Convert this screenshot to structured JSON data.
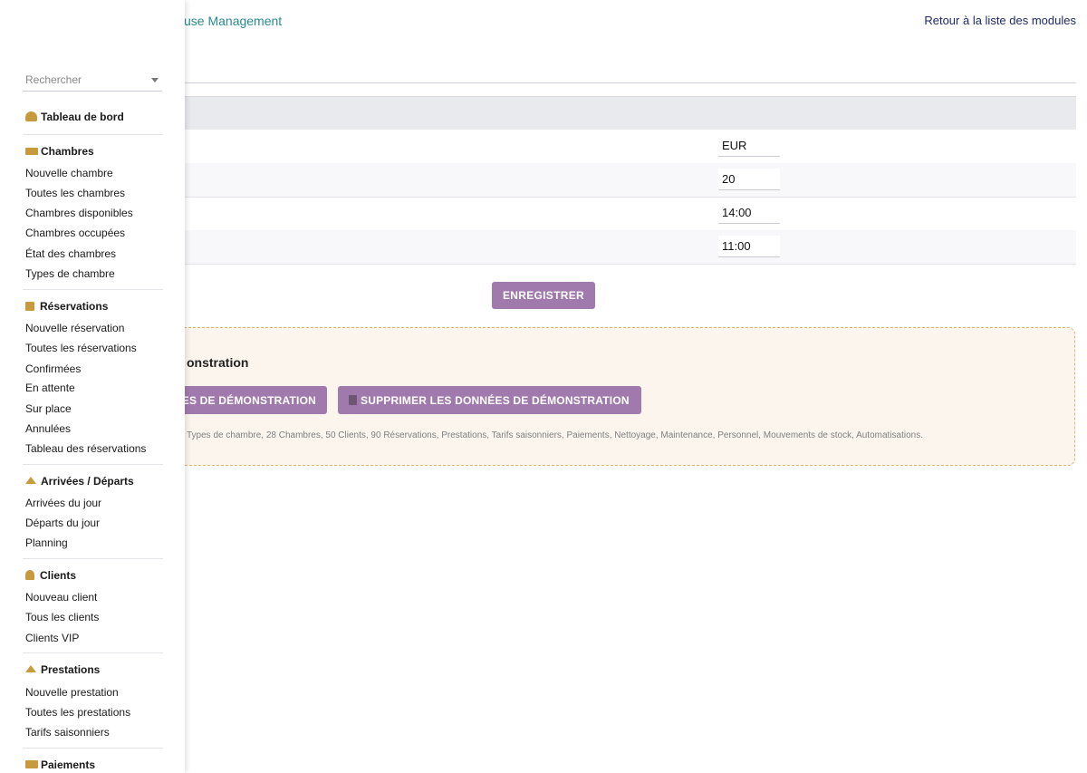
{
  "header": {
    "module_title": "use Management",
    "back_link": "Retour à la liste des modules"
  },
  "settings_rows": [
    {
      "value": "EUR"
    },
    {
      "value": "20"
    },
    {
      "value": "14:00"
    },
    {
      "value": "11:00"
    }
  ],
  "save_button": "ENREGISTRER",
  "demo": {
    "title": "onstration",
    "load_button": "ES DE DÉMONSTRATION",
    "delete_button": "SUPPRIMER LES DONNÉES DE DÉMONSTRATION",
    "note": "Types de chambre, 28 Chambres, 50 Clients, 90 Réservations, Prestations, Tarifs saisonniers, Paiements, Nettoyage, Maintenance, Personnel, Mouvements de stock, Automatisations."
  },
  "sidebar": {
    "search_placeholder": "Rechercher",
    "dashboard": "Tableau de bord",
    "chambres": {
      "title": "Chambres",
      "items": [
        "Nouvelle chambre",
        "Toutes les chambres",
        "Chambres disponibles",
        "Chambres occupées",
        "État des chambres",
        "Types de chambre"
      ]
    },
    "reservations": {
      "title": "Réservations",
      "items": [
        "Nouvelle réservation",
        "Toutes les réservations",
        "Confirmées",
        "En attente",
        "Sur place",
        "Annulées",
        "Tableau des réservations"
      ]
    },
    "arrivees": {
      "title": "Arrivées / Départs",
      "items": [
        "Arrivées du jour",
        "Départs du jour",
        "Planning"
      ]
    },
    "clients": {
      "title": "Clients",
      "items": [
        "Nouveau client",
        "Tous les clients",
        "Clients VIP"
      ]
    },
    "prestations": {
      "title": "Prestations",
      "items": [
        "Nouvelle prestation",
        "Toutes les prestations",
        "Tarifs saisonniers"
      ]
    },
    "paiements": {
      "title": "Paiements"
    }
  },
  "colors": {
    "accent_button": "#a07aac",
    "sidebar_icon": "#c79a3d",
    "link_teal": "#2a8a8e",
    "link_navy": "#1f2a6b"
  }
}
